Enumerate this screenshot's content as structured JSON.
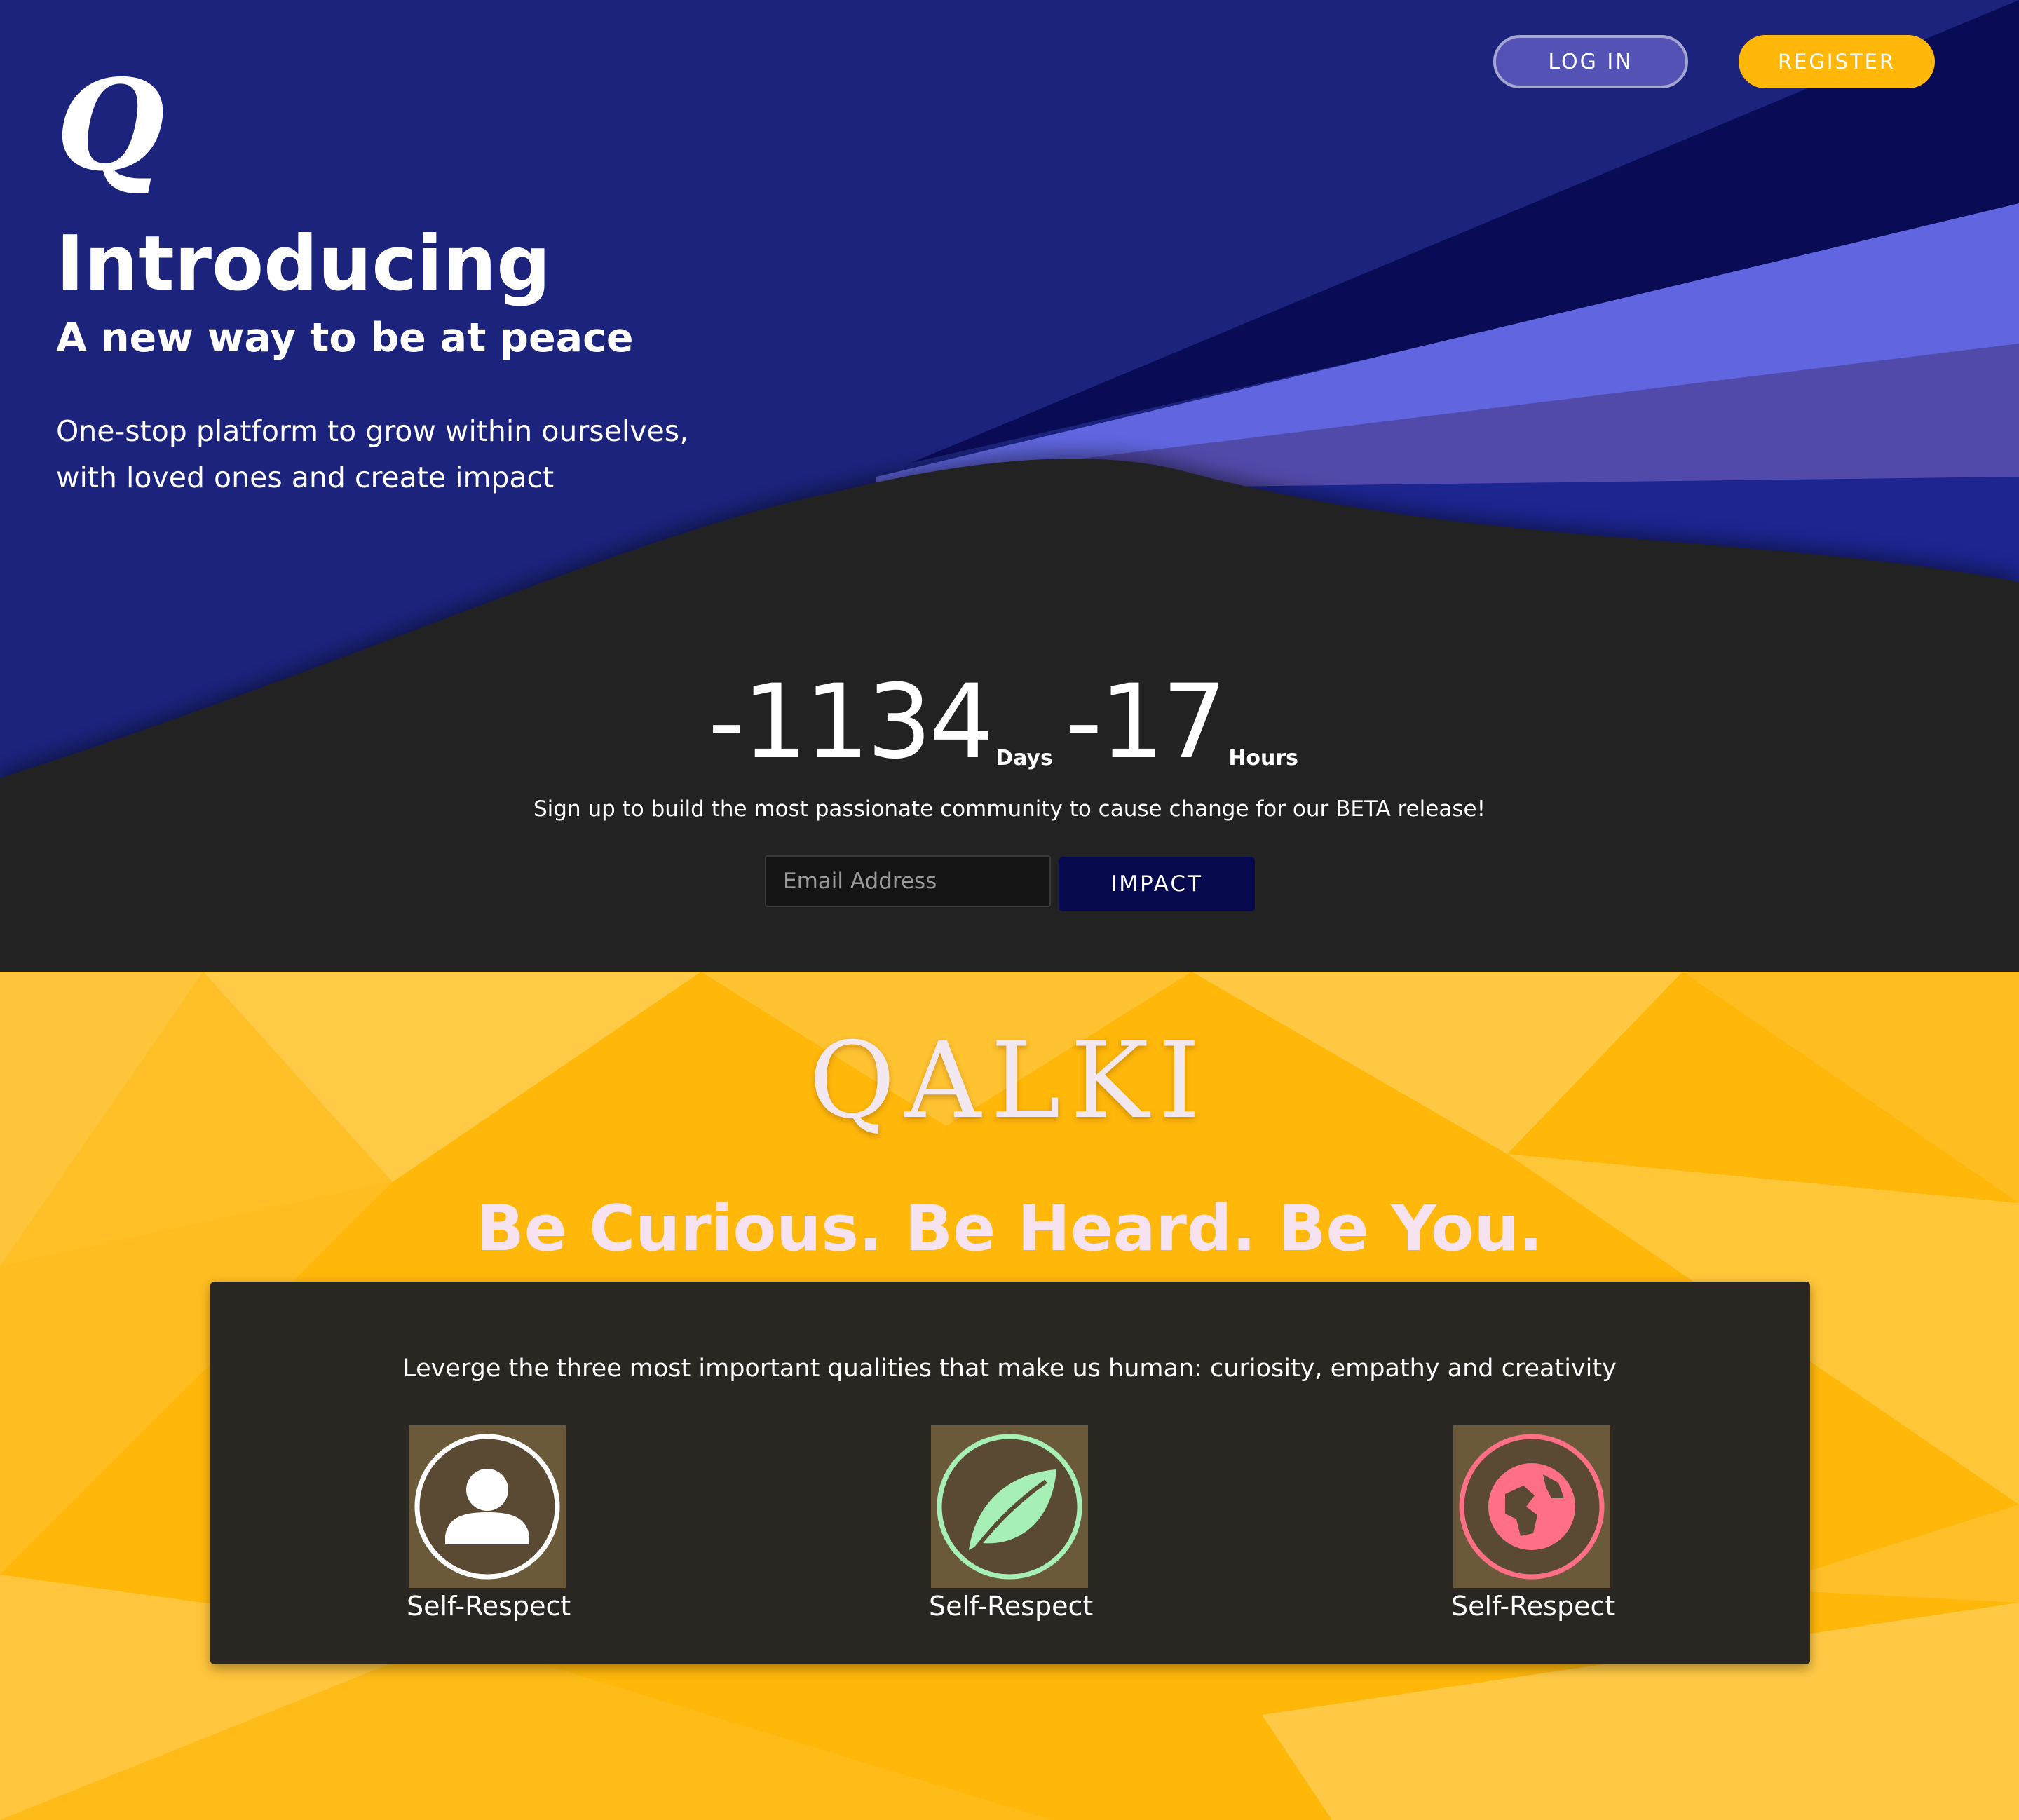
{
  "header": {
    "logo_letter": "Q",
    "login_label": "LOG IN",
    "register_label": "REGISTER"
  },
  "hero": {
    "title": "Introducing",
    "subtitle": "A new way to be at peace",
    "tagline_line1": "One-stop platform to grow within ourselves,",
    "tagline_line2": "with loved ones and create impact"
  },
  "countdown": {
    "days_value": "-1134",
    "days_unit": "Days",
    "hours_value": "-17",
    "hours_unit": "Hours"
  },
  "signup": {
    "text": "Sign up to build the most passionate community to cause change for our BETA release!",
    "email_placeholder": "Email Address",
    "button_label": "IMPACT"
  },
  "brand": {
    "name": "QALKI",
    "slogan": "Be Curious. Be Heard. Be You."
  },
  "qualities": {
    "intro": "Leverge the three most important qualities that make us human: curiosity, empathy and creativity",
    "items": [
      {
        "label": "Self-Respect",
        "icon": "person-icon",
        "ring_color": "#ffffff"
      },
      {
        "label": "Self-Respect",
        "icon": "leaf-icon",
        "ring_color": "#a6f0b8"
      },
      {
        "label": "Self-Respect",
        "icon": "globe-icon",
        "ring_color": "#ff6f86"
      }
    ]
  },
  "colors": {
    "hero_blue": "#1b237d",
    "accent_yellow": "#ffb70a",
    "impact_navy": "#07094f"
  }
}
